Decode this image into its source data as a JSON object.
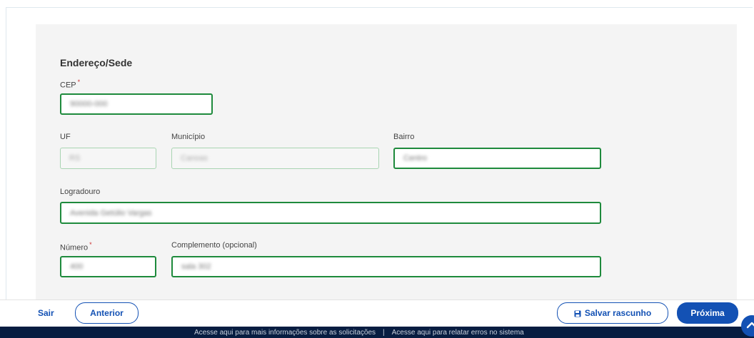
{
  "section_title": "Endereço/Sede",
  "cep": {
    "label": "CEP",
    "required_mark": "*",
    "value": "90000-000"
  },
  "uf": {
    "label": "UF",
    "value": "RS"
  },
  "municipio": {
    "label": "Município",
    "value": "Canoas"
  },
  "bairro": {
    "label": "Bairro",
    "value": "Centro"
  },
  "logradouro": {
    "label": "Logradouro",
    "value": "Avenida Getúlio Vargas"
  },
  "numero": {
    "label": "Número",
    "required_mark": "*",
    "value": "400"
  },
  "complemento": {
    "label": "Complemento (opcional)",
    "value": "sala 302"
  },
  "footer": {
    "sair": "Sair",
    "anterior": "Anterior",
    "salvar": "Salvar rascunho",
    "proxima": "Próxima"
  },
  "bottom_links": {
    "info": "Acesse aqui para mais informações sobre as solicitações",
    "separator": "|",
    "erros": "Acesse aqui para relatar erros no sistema"
  },
  "colors": {
    "primary": "#1351b4",
    "field_border": "#1e8a3c",
    "bottom_bar": "#071d41"
  },
  "icons": {
    "save": "floppy-disk-icon",
    "scroll_top": "chevron-up-icon"
  }
}
